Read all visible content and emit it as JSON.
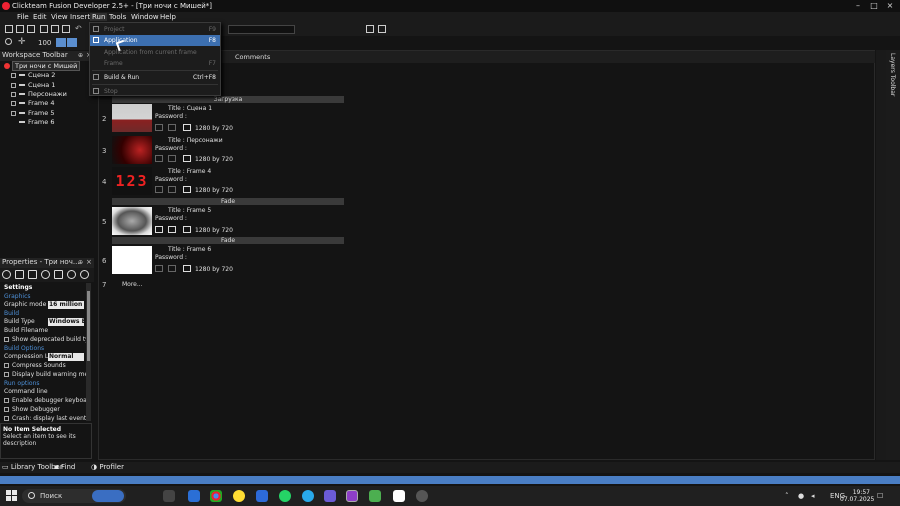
{
  "window": {
    "title": "Clickteam Fusion Developer 2.5+ - [Три ночи с Мишей*]"
  },
  "menubar": [
    "File",
    "Edit",
    "View",
    "Insert",
    "Run",
    "Tools",
    "Window",
    "Help"
  ],
  "toolbar": {
    "zoom_value": "100"
  },
  "run_menu": {
    "items": [
      {
        "label": "Project",
        "shortcut": "F9",
        "enabled": false
      },
      {
        "label": "Application",
        "shortcut": "F8",
        "enabled": true,
        "highlighted": true
      },
      {
        "label": "Application from current frame",
        "shortcut": "",
        "enabled": false
      },
      {
        "label": "Frame",
        "shortcut": "F7",
        "enabled": false
      },
      {
        "label": "Build & Run",
        "shortcut": "Ctrl+F8",
        "enabled": true
      },
      {
        "label": "Stop",
        "shortcut": "",
        "enabled": false
      }
    ]
  },
  "workspace": {
    "header": "Workspace Toolbar",
    "root": "Три ночи с Мишей",
    "items": [
      "Сцена 2",
      "Сцена 1",
      "Персонажи",
      "Frame 4",
      "Frame 5",
      "Frame 6"
    ]
  },
  "properties": {
    "header": "Properties - Три ноч...",
    "rows": [
      {
        "type": "head",
        "key": "Settings"
      },
      {
        "type": "cat",
        "key": "Graphics"
      },
      {
        "type": "kv",
        "key": "Graphic mode",
        "value": "16 million c"
      },
      {
        "type": "cat",
        "key": "Build"
      },
      {
        "type": "kv",
        "key": "Build Type",
        "value": "Windows E"
      },
      {
        "type": "kv",
        "key": "Build Filename",
        "value": ""
      },
      {
        "type": "check",
        "key": "Show deprecated build ty"
      },
      {
        "type": "cat",
        "key": "Build Options"
      },
      {
        "type": "kv",
        "key": "Compression Le",
        "value": "Normal"
      },
      {
        "type": "check",
        "key": "Compress Sounds"
      },
      {
        "type": "check",
        "key": "Display build warning me"
      },
      {
        "type": "cat",
        "key": "Run options"
      },
      {
        "type": "kv",
        "key": "Command line",
        "value": ""
      },
      {
        "type": "check",
        "key": "Enable debugger keyboa"
      },
      {
        "type": "check",
        "key": "Show Debugger"
      },
      {
        "type": "check",
        "key": "Crash: display last event"
      }
    ],
    "desc_title": "No Item Selected",
    "desc_text": "Select an item to see its description"
  },
  "storyboard": {
    "comments_header": "Comments",
    "band_top": "Загрузка",
    "band_fade": "Fade",
    "title_prefix": "Title :",
    "password_label": "Password :",
    "size_by": "by",
    "frames": [
      {
        "num": "2",
        "title": "Сцена 1",
        "w": "1280",
        "h": "720"
      },
      {
        "num": "3",
        "title": "Персонажи",
        "w": "1280",
        "h": "720"
      },
      {
        "num": "4",
        "title": "Frame 4",
        "w": "1280",
        "h": "720"
      },
      {
        "num": "5",
        "title": "Frame 5",
        "w": "1280",
        "h": "720"
      },
      {
        "num": "6",
        "title": "Frame 6",
        "w": "1280",
        "h": "720"
      }
    ],
    "more_num": "7",
    "more_label": "More..."
  },
  "layers_label": "Layers Toolbar",
  "bottom_tabs": [
    "Library Toolbar",
    "Find",
    "Profiler"
  ],
  "taskbar": {
    "search_label": "Поиск",
    "lang": "ENG",
    "time": "19:57",
    "date": "07.07.2025"
  }
}
